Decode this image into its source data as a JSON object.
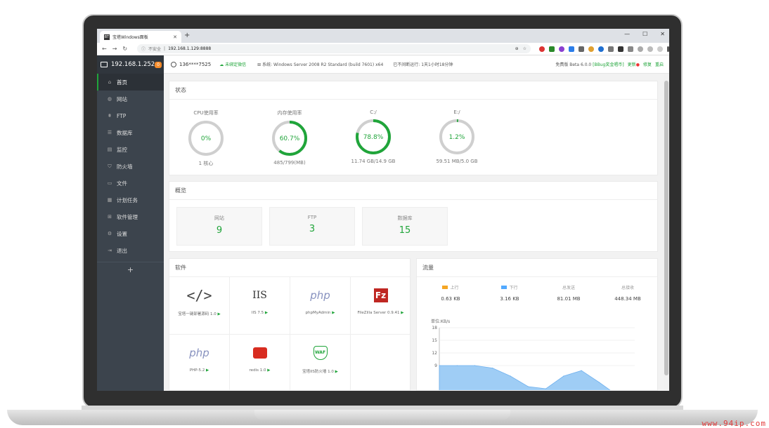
{
  "browser": {
    "tab_icon": "BT",
    "tab_title": "宝塔Windows面板",
    "security": "不安全",
    "url": "192.168.1.129:8888"
  },
  "sidebar": {
    "host": "192.168.1.252",
    "badge": "0",
    "items": [
      {
        "icon": "home-icon",
        "glyph": "⌂",
        "label": "首页",
        "active": true
      },
      {
        "icon": "globe-icon",
        "glyph": "◍",
        "label": "网站",
        "active": false
      },
      {
        "icon": "ftp-icon",
        "glyph": "⩩",
        "label": "FTP",
        "active": false
      },
      {
        "icon": "database-icon",
        "glyph": "☰",
        "label": "数据库",
        "active": false
      },
      {
        "icon": "monitor-icon",
        "glyph": "▤",
        "label": "监控",
        "active": false
      },
      {
        "icon": "shield-icon",
        "glyph": "⛉",
        "label": "防火墙",
        "active": false
      },
      {
        "icon": "folder-icon",
        "glyph": "▭",
        "label": "文件",
        "active": false
      },
      {
        "icon": "calendar-icon",
        "glyph": "▦",
        "label": "计划任务",
        "active": false
      },
      {
        "icon": "apps-icon",
        "glyph": "⊞",
        "label": "软件管理",
        "active": false
      },
      {
        "icon": "gear-icon",
        "glyph": "⚙",
        "label": "设置",
        "active": false
      },
      {
        "icon": "logout-icon",
        "glyph": "⇥",
        "label": "退出",
        "active": false
      }
    ],
    "add": "+"
  },
  "topinfo": {
    "user": "136****7525",
    "wechat": "未绑定微信",
    "system_label": "系统:",
    "system": "Windows Server 2008 R2 Standard (build 7601) x64",
    "uptime": "已不间断运行: 1天1小时18分钟",
    "version": "免费版 Beta 6.0.0",
    "bug": "[BBug奖金唱币]",
    "update": "更新",
    "repair": "修复",
    "restart": "重启"
  },
  "status": {
    "title": "状态",
    "gauges": [
      {
        "label": "CPU使用率",
        "value": "0%",
        "percent": 0,
        "sub": "1 核心"
      },
      {
        "label": "内存使用率",
        "value": "60.7%",
        "percent": 60.7,
        "sub": "485/799(MB)"
      },
      {
        "label": "C:/",
        "value": "78.8%",
        "percent": 78.8,
        "sub": "11.74 GB/14.9 GB"
      },
      {
        "label": "E:/",
        "value": "1.2%",
        "percent": 1.2,
        "sub": "59.51 MB/5.0 GB"
      }
    ]
  },
  "overview": {
    "title": "概览",
    "cards": [
      {
        "label": "网站",
        "value": "9"
      },
      {
        "label": "FTP",
        "value": "3"
      },
      {
        "label": "数据库",
        "value": "15"
      }
    ]
  },
  "software": {
    "title": "软件",
    "items": [
      {
        "icon": "code-icon",
        "name": "宝塔一键部署源码 1.0"
      },
      {
        "icon": "iis-icon",
        "name": "IIS 7.5"
      },
      {
        "icon": "php-icon",
        "name": "phpMyAdmin"
      },
      {
        "icon": "filezilla-icon",
        "name": "FileZilla Server 0.9.41"
      },
      {
        "icon": "php-icon",
        "name": "PHP-5.2"
      },
      {
        "icon": "redis-icon",
        "name": "redis 1.0"
      },
      {
        "icon": "waf-icon",
        "name": "宝塔IIS防火墙 1.0"
      }
    ],
    "iis_text": "IIS",
    "php_text": "php",
    "waf_text": "WAF"
  },
  "traffic": {
    "title": "流量",
    "stats": [
      {
        "label": "上行",
        "value": "0.63 KB",
        "color": "#f5a623"
      },
      {
        "label": "下行",
        "value": "3.16 KB",
        "color": "#52a9ff"
      },
      {
        "label": "总发送",
        "value": "81.01 MB",
        "color": ""
      },
      {
        "label": "总接收",
        "value": "448.34 MB",
        "color": ""
      }
    ],
    "unit": "单位:KB/s"
  },
  "chart_data": {
    "type": "area",
    "ylabel": "单位:KB/s",
    "ylim": [
      0,
      18
    ],
    "yticks": [
      18,
      15,
      12,
      9
    ],
    "series": [
      {
        "values": [
          9,
          9,
          9,
          8.4,
          6.5,
          4,
          3.5,
          6.5,
          7.8,
          5,
          2,
          1
        ]
      }
    ]
  },
  "watermark": "www.94ip.com"
}
